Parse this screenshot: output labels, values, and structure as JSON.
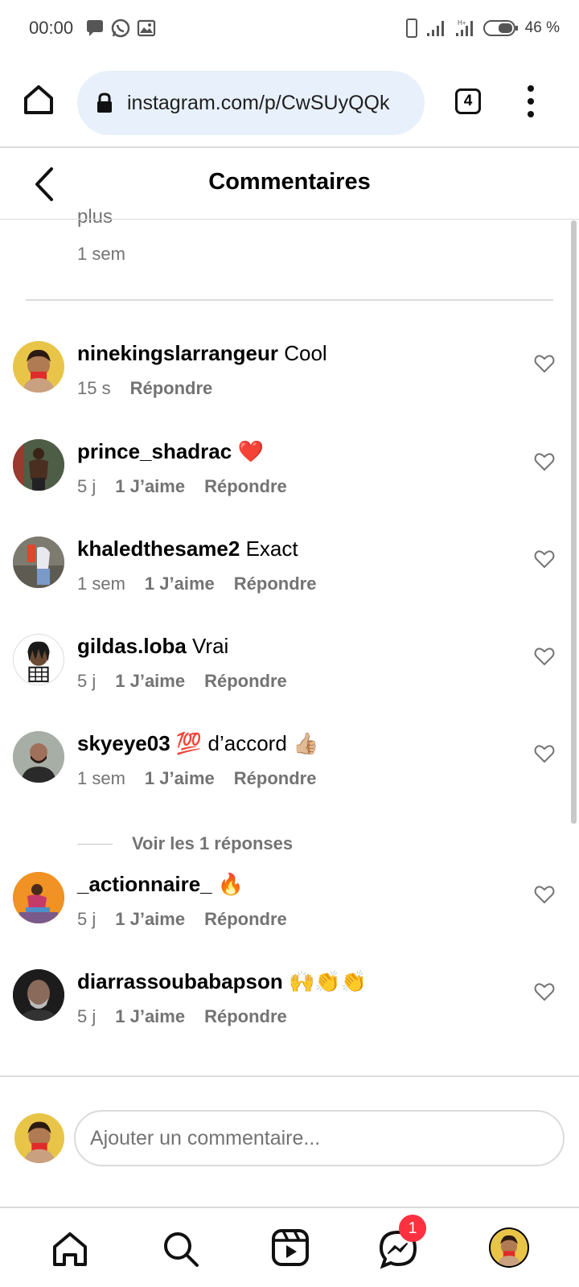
{
  "status_bar": {
    "time": "00:00",
    "battery": "46 %"
  },
  "browser": {
    "url": "instagram.com/p/CwSUyQQk",
    "tab_count": "4"
  },
  "header": {
    "title": "Commentaires"
  },
  "previous": {
    "more_text": "plus",
    "time": "1 sem"
  },
  "comments": [
    {
      "user": "ninekingslarrangeur",
      "text": "Cool",
      "time": "15 s",
      "likes": "",
      "reply": "Répondre"
    },
    {
      "user": "prince_shadrac",
      "text": "❤️",
      "time": "5 j",
      "likes": "1 J’aime",
      "reply": "Répondre"
    },
    {
      "user": "khaledthesame2",
      "text": "Exact",
      "time": "1 sem",
      "likes": "1 J’aime",
      "reply": "Répondre"
    },
    {
      "user": "gildas.loba",
      "text": "Vrai",
      "time": "5 j",
      "likes": "1 J’aime",
      "reply": "Répondre"
    },
    {
      "user": "skyeye03",
      "text": "💯 d’accord 👍🏼",
      "time": "1 sem",
      "likes": "1 J’aime",
      "reply": "Répondre"
    },
    {
      "user": "_actionnaire_",
      "text": "🔥",
      "time": "5 j",
      "likes": "1 J’aime",
      "reply": "Répondre"
    },
    {
      "user": "diarrassoubabapson",
      "text": "🙌👏👏",
      "time": "5 j",
      "likes": "1 J’aime",
      "reply": "Répondre"
    }
  ],
  "view_replies": "Voir les 1 réponses",
  "composer": {
    "placeholder": "Ajouter un commentaire..."
  },
  "nav": {
    "messages_badge": "1"
  },
  "colors": {
    "accent_red": "#ff3040",
    "secondary_text": "#737373",
    "url_bg": "#e8f0fb"
  }
}
